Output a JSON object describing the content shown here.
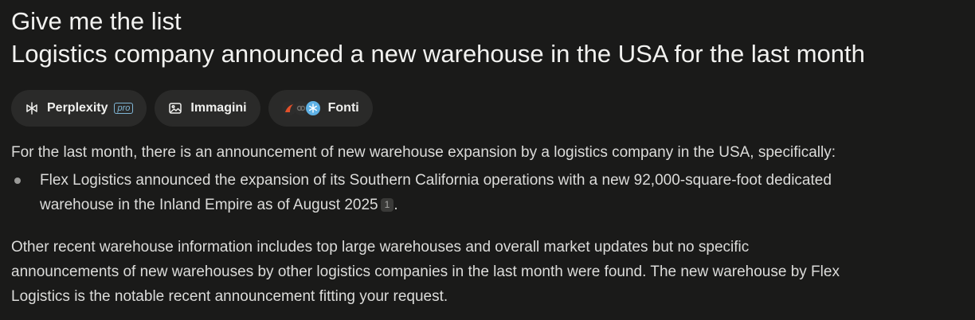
{
  "query": {
    "line1": "Give me the list",
    "line2": "Logistics company announced a new warehouse in the  USA for the last month"
  },
  "tabs": [
    {
      "label": "Perplexity",
      "badge": "pro",
      "icon": "perplexity-icon"
    },
    {
      "label": "Immagini",
      "icon": "image-icon"
    },
    {
      "label": "Fonti",
      "icon": "sources-icon"
    }
  ],
  "answer": {
    "intro": "For the last month, there is an announcement of new warehouse expansion by a logistics company in the USA, specifically:",
    "bullets": [
      {
        "line1": "Flex Logistics announced the expansion of its Southern California operations with a new 92,000-square-foot dedicated",
        "line2": "warehouse in the Inland Empire as of August 2025",
        "citation": "1",
        "end": "."
      }
    ],
    "para2": {
      "line1": "Other recent warehouse information includes top large warehouses and overall market updates but no specific",
      "line2": "announcements of new warehouses by other logistics companies in the last month were found. The new warehouse by Flex",
      "line3": "Logistics is the notable recent announcement fitting your request."
    }
  },
  "colors": {
    "background": "#1a1a19",
    "tab_bg": "#2a2a29",
    "pro_badge": "#7fb6d6"
  }
}
